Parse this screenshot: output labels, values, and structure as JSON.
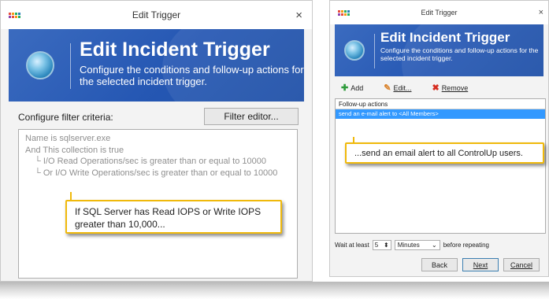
{
  "left": {
    "title": "Edit Trigger",
    "close": "×",
    "banner": {
      "title": "Edit Incident Trigger",
      "subtitle": "Configure the conditions and follow-up actions for the selected incident trigger."
    },
    "filter_label": "Configure filter criteria:",
    "filter_button": "Filter editor...",
    "criteria": [
      "Name is sqlserver.exe",
      "And This collection is true",
      "└ I/O Read Operations/sec is greater than or equal to 10000",
      "└ Or I/O Write Operations/sec is greater than or equal to 10000"
    ],
    "callout": "If SQL Server has Read IOPS or Write IOPS greater than 10,000..."
  },
  "right": {
    "title": "Edit Trigger",
    "close": "×",
    "banner": {
      "title": "Edit Incident Trigger",
      "subtitle": "Configure the conditions and follow-up actions for the selected incident trigger."
    },
    "toolbar": {
      "add": "Add",
      "edit": "Edit...",
      "remove": "Remove"
    },
    "list_header": "Follow-up actions",
    "list_row": "send an e-mail alert to <All Members>",
    "callout": "...send an email alert to all ControlUp users.",
    "wait": {
      "label": "Wait at least",
      "value": "5",
      "unit": "Minutes",
      "suffix": "before repeating"
    },
    "buttons": {
      "back": "Back",
      "next": "Next",
      "cancel": "Cancel"
    }
  },
  "icons": {
    "app": "controlup-grid-icon",
    "globe": "globe-icon",
    "add": "plus-icon",
    "edit": "pencil-icon",
    "remove": "x-icon"
  },
  "colors": {
    "banner": "#2557b3",
    "selection": "#3399ff",
    "callout_border": "#f0b90b"
  }
}
